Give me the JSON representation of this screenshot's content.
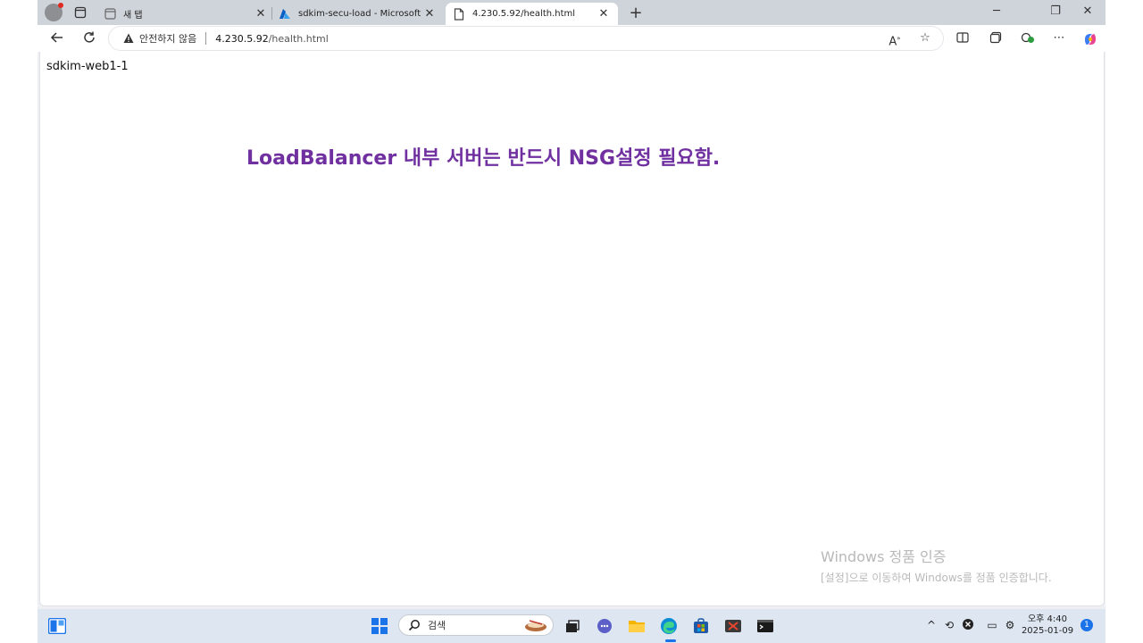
{
  "browser": {
    "tabs": [
      {
        "title": "새 탭",
        "active": false,
        "favicon": "new-tab-page-icon"
      },
      {
        "title": "sdkim-secu-load - Microsoft Azure",
        "active": false,
        "favicon": "azure-icon"
      },
      {
        "title": "4.230.5.92/health.html",
        "active": true,
        "favicon": "page-icon"
      }
    ],
    "new_tab_label": "+",
    "address": {
      "security_label": "안전하지 않음",
      "host": "4.230.5.92",
      "path": "/health.html"
    },
    "accent_color": "#1a73e8"
  },
  "page": {
    "server_name": "sdkim-web1-1",
    "headline": "LoadBalancer 내부 서버는 반드시 NSG설정 필요함.",
    "headline_color": "#7030a0"
  },
  "watermark": {
    "title": "Windows 정품 인증",
    "subtitle": "[설정]으로 이동하여 Windows를 정품 인증합니다."
  },
  "taskbar": {
    "search_label": "검색",
    "time": "오후 4:40",
    "date": "2025-01-09",
    "notification_count": "1"
  }
}
